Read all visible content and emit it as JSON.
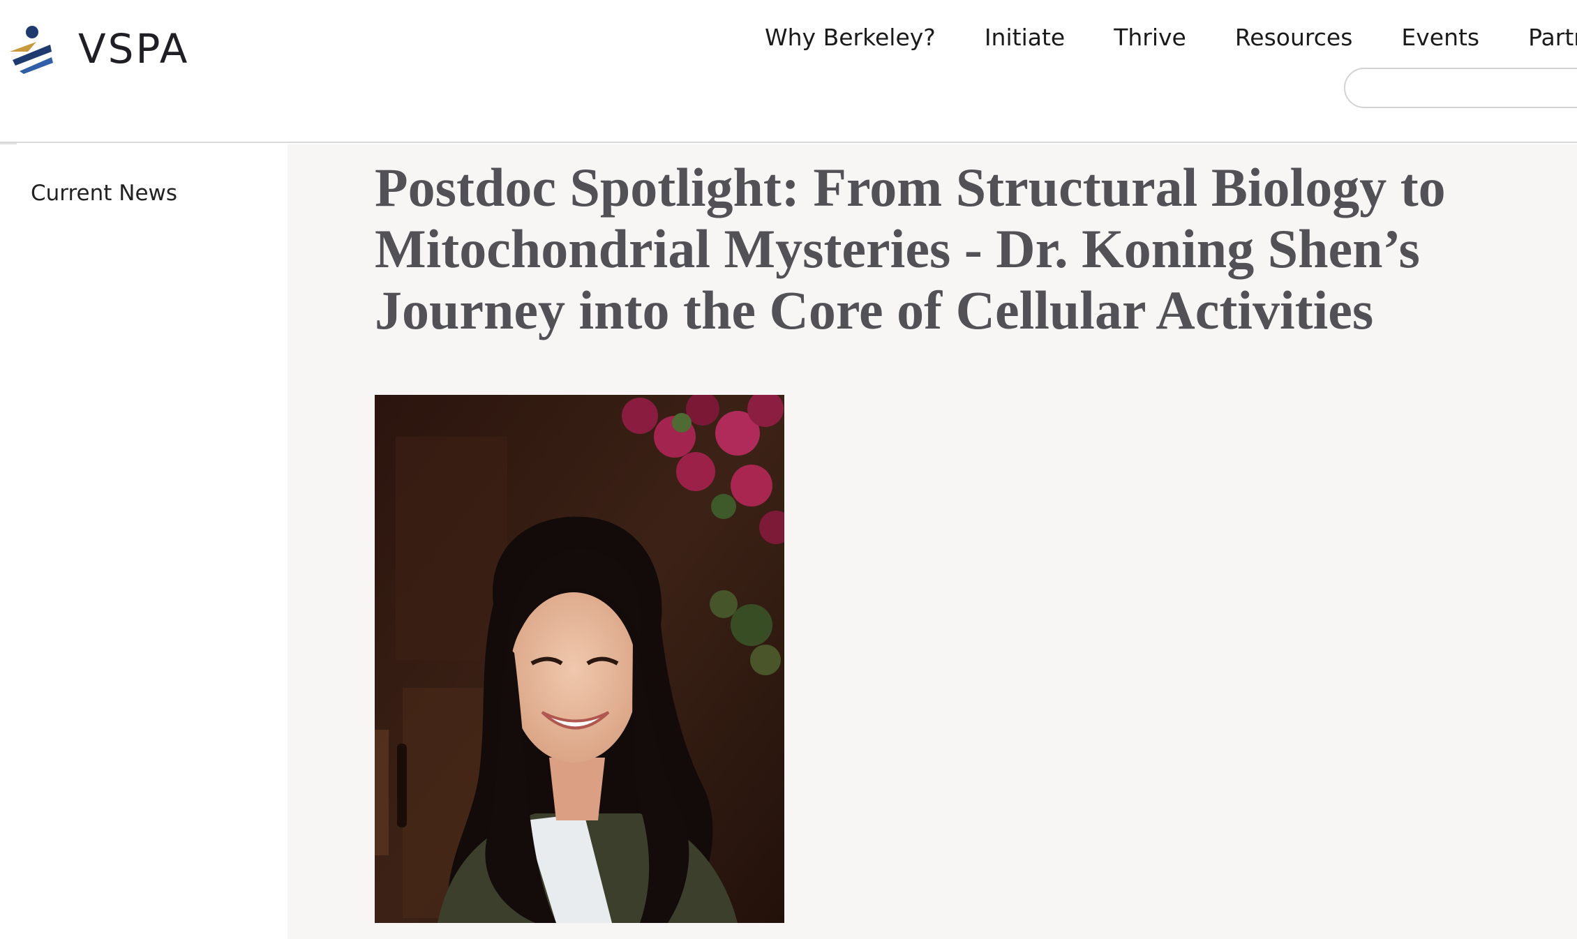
{
  "brand": {
    "name": "VSPA",
    "logo_icon": "vspa-logo-icon"
  },
  "nav": {
    "items": [
      "Why Berkeley?",
      "Initiate",
      "Thrive",
      "Resources",
      "Events",
      "Partners"
    ]
  },
  "search": {
    "placeholder": "",
    "icon": "search-field"
  },
  "sidebar": {
    "items": [
      {
        "label": "Current News"
      }
    ]
  },
  "article": {
    "title": "Postdoc Spotlight: From Structural Biology to Mitochondrial Mysteries - Dr. Koning Shen’s Journey into the Core of Cellular Activities",
    "photo_description_icon": "portrait-photo"
  },
  "colors": {
    "title": "#515156",
    "main_bg": "#f7f6f5",
    "logo_navy": "#1f3a6e",
    "logo_gold": "#c99a3c"
  }
}
